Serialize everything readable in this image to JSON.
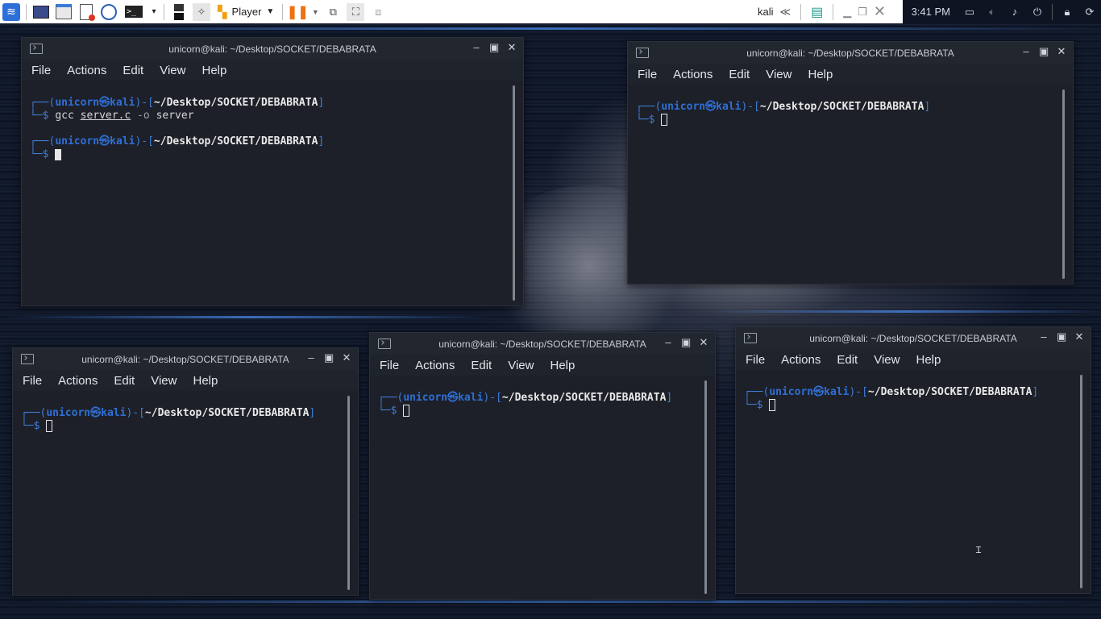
{
  "panel": {
    "player_label": "Player",
    "user_label": "kali",
    "clock": "3:41 PM"
  },
  "terminals": [
    {
      "title": "unicorn@kali: ~/Desktop/SOCKET/DEBABRATA",
      "menu": [
        "File",
        "Actions",
        "Edit",
        "View",
        "Help"
      ],
      "prompt_user": "unicorn",
      "prompt_host": "kali",
      "prompt_path": "~/Desktop/SOCKET/DEBABRATA",
      "cmd_word": "gcc",
      "cmd_file": "server.c",
      "cmd_flag": "-o",
      "cmd_out": "server"
    },
    {
      "title": "unicorn@kali: ~/Desktop/SOCKET/DEBABRATA",
      "menu": [
        "File",
        "Actions",
        "Edit",
        "View",
        "Help"
      ],
      "prompt_user": "unicorn",
      "prompt_host": "kali",
      "prompt_path": "~/Desktop/SOCKET/DEBABRATA"
    },
    {
      "title": "unicorn@kali: ~/Desktop/SOCKET/DEBABRATA",
      "menu": [
        "File",
        "Actions",
        "Edit",
        "View",
        "Help"
      ],
      "prompt_user": "unicorn",
      "prompt_host": "kali",
      "prompt_path": "~/Desktop/SOCKET/DEBABRATA"
    },
    {
      "title": "unicorn@kali: ~/Desktop/SOCKET/DEBABRATA",
      "menu": [
        "File",
        "Actions",
        "Edit",
        "View",
        "Help"
      ],
      "prompt_user": "unicorn",
      "prompt_host": "kali",
      "prompt_path": "~/Desktop/SOCKET/DEBABRATA"
    },
    {
      "title": "unicorn@kali: ~/Desktop/SOCKET/DEBABRATA",
      "menu": [
        "File",
        "Actions",
        "Edit",
        "View",
        "Help"
      ],
      "prompt_user": "unicorn",
      "prompt_host": "kali",
      "prompt_path": "~/Desktop/SOCKET/DEBABRATA"
    }
  ]
}
